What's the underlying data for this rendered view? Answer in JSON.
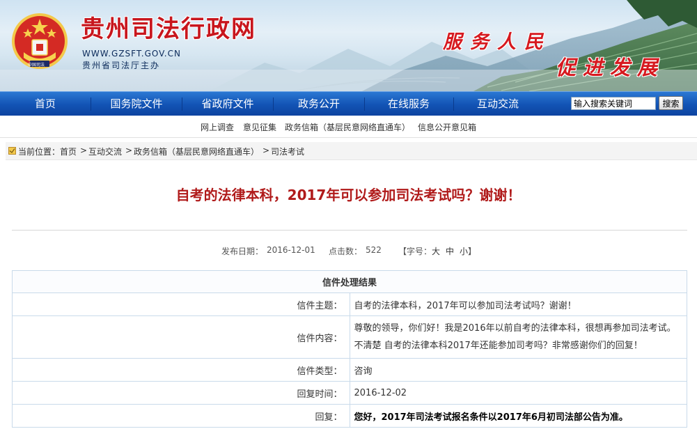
{
  "banner": {
    "site_title": "贵州司法行政网",
    "site_url": "WWW.GZSFT.GOV.CN",
    "site_host": "贵州省司法厅主办",
    "slogan_line1": "服务人民",
    "slogan_line2": "促进发展",
    "emblem_text": "中国司法",
    "title_color": "#c8161d"
  },
  "nav": {
    "items": [
      "首页",
      "国务院文件",
      "省政府文件",
      "政务公开",
      "在线服务",
      "互动交流"
    ],
    "search_value": "输入搜索关键词",
    "search_button": "搜索",
    "bg_color": "#1253b4"
  },
  "subnav": {
    "items": [
      "网上调查",
      "意见征集",
      "政务信箱（基层民意网络直通车）",
      "信息公开意见箱"
    ]
  },
  "breadcrumb": {
    "label": "当前位置：",
    "items": [
      "首页",
      "互动交流",
      "政务信箱（基层民意网络直通车）",
      "司法考试"
    ],
    "separator": ">"
  },
  "article": {
    "title": "自考的法律本科，2017年可以参加司法考试吗？谢谢！",
    "title_color": "#b01a1a",
    "publish_label": "发布日期：",
    "publish_date": "2016-12-01",
    "clicks_label": "点击数：",
    "clicks": "522",
    "font_label": "【字号：",
    "font_large": "大",
    "font_medium": "中",
    "font_small": "小",
    "font_close": "】"
  },
  "result_table": {
    "header": "信件处理结果",
    "rows": [
      {
        "label": "信件主题：",
        "value": "自考的法律本科，2017年可以参加司法考试吗？谢谢！"
      },
      {
        "label": "信件内容：",
        "value": "尊敬的领导，你们好！我是2016年以前自考的法律本科，很想再参加司法考试。不清楚 自考的法律本科2017年还能参加司考吗？非常感谢你们的回复！"
      },
      {
        "label": "信件类型：",
        "value": "咨询"
      },
      {
        "label": "回复时间：",
        "value": "2016-12-02"
      },
      {
        "label": "回复：",
        "value": "您好，2017年司法考试报名条件以2017年6月初司法部公告为准。"
      }
    ],
    "border_color": "#c9daea"
  }
}
